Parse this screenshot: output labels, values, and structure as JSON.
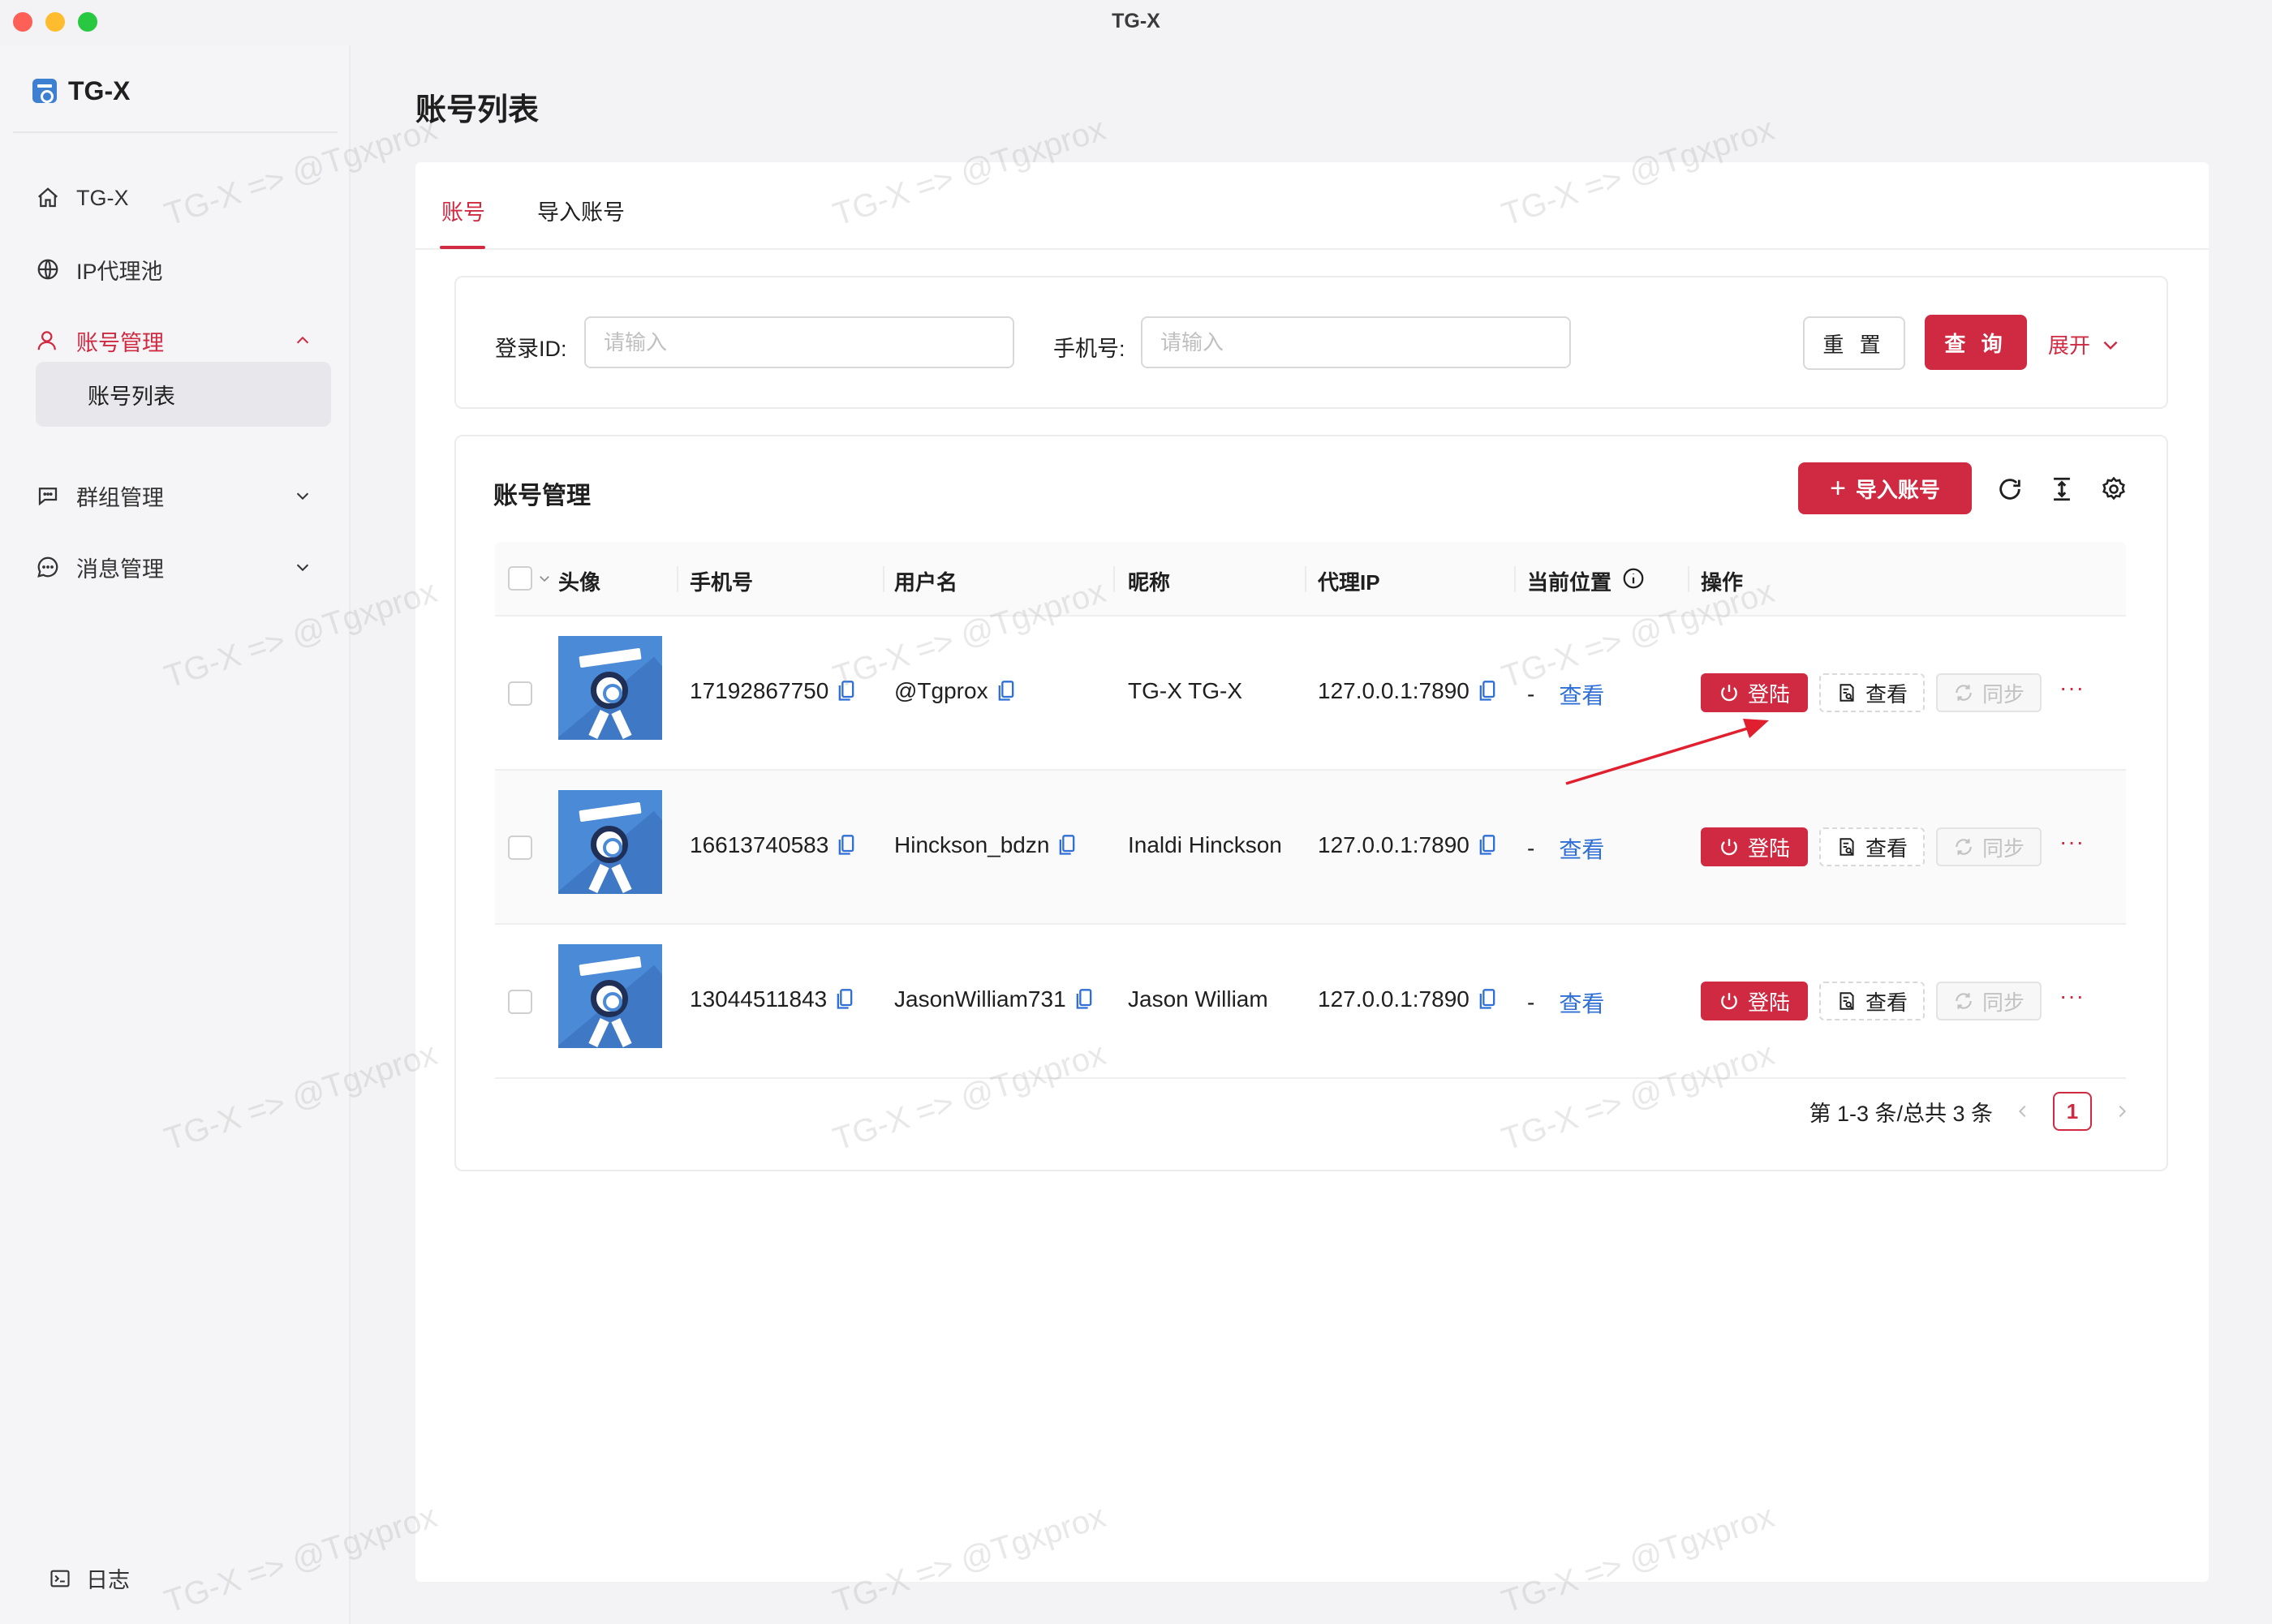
{
  "window": {
    "title": "TG-X"
  },
  "sidebar": {
    "brand": "TG-X",
    "items": [
      {
        "label": "TG-X",
        "icon": "home-icon"
      },
      {
        "label": "IP代理池",
        "icon": "globe-icon"
      },
      {
        "label": "账号管理",
        "icon": "user-icon",
        "expanded": true
      },
      {
        "label": "群组管理",
        "icon": "group-chat-icon"
      },
      {
        "label": "消息管理",
        "icon": "message-icon"
      }
    ],
    "sub_item": "账号列表",
    "log": "日志"
  },
  "page": {
    "title": "账号列表"
  },
  "tabs": [
    {
      "label": "账号",
      "active": true
    },
    {
      "label": "导入账号",
      "active": false
    }
  ],
  "search": {
    "login_id_label": "登录ID:",
    "login_id_placeholder": "请输入",
    "phone_label": "手机号:",
    "phone_placeholder": "请输入",
    "reset": "重 置",
    "query": "查 询",
    "expand": "展开"
  },
  "table": {
    "title": "账号管理",
    "import_button": "导入账号",
    "columns": [
      "头像",
      "手机号",
      "用户名",
      "昵称",
      "代理IP",
      "当前位置",
      "操作"
    ],
    "rows": [
      {
        "phone": "17192867750",
        "username": "@Tgprox",
        "nickname": "TG-X TG-X",
        "proxy": "127.0.0.1:7890",
        "location": "-",
        "location_link": "查看"
      },
      {
        "phone": "16613740583",
        "username": "Hinckson_bdzn",
        "nickname": "Inaldi Hinckson",
        "proxy": "127.0.0.1:7890",
        "location": "-",
        "location_link": "查看"
      },
      {
        "phone": "13044511843",
        "username": "JasonWilliam731",
        "nickname": "Jason William",
        "proxy": "127.0.0.1:7890",
        "location": "-",
        "location_link": "查看"
      }
    ],
    "actions": {
      "login": "登陆",
      "view": "查看",
      "sync": "同步",
      "more": "···"
    }
  },
  "pagination": {
    "summary": "第 1-3 条/总共 3 条",
    "current": "1"
  },
  "watermark": "TG-X => @Tgxprox",
  "colors": {
    "accent": "#cf2a41",
    "link": "#2f6fd6"
  }
}
